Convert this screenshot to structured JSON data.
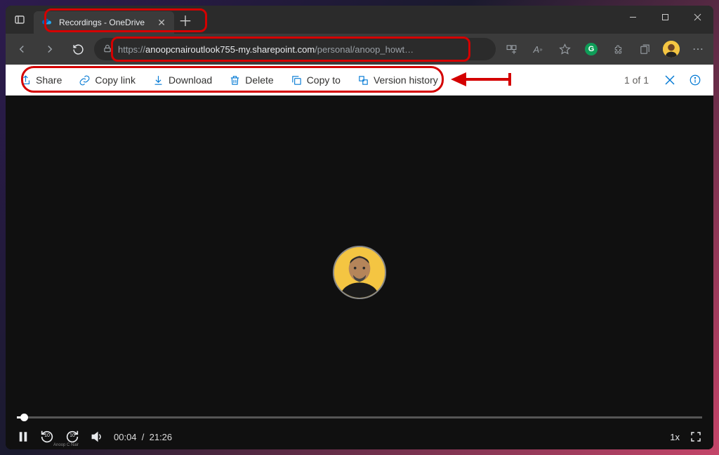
{
  "tab": {
    "title": "Recordings - OneDrive"
  },
  "url": {
    "protocol": "https://",
    "host": "anoopcnairoutlook755-my.sharepoint.com",
    "path": "/personal/anoop_howt…"
  },
  "toolbar": {
    "share": "Share",
    "copy_link": "Copy link",
    "download": "Download",
    "delete": "Delete",
    "copy_to": "Copy to",
    "version_history": "Version history",
    "counter": "1 of 1"
  },
  "player": {
    "current_time": "00:04",
    "duration": "21:26",
    "speed": "1x",
    "skip_back": "10",
    "skip_fwd": "10",
    "progress_pct": 1.0,
    "speaker_name": "Anoop C Nair"
  },
  "colors": {
    "annotation": "#d40000",
    "ms_blue": "#0078d4"
  }
}
